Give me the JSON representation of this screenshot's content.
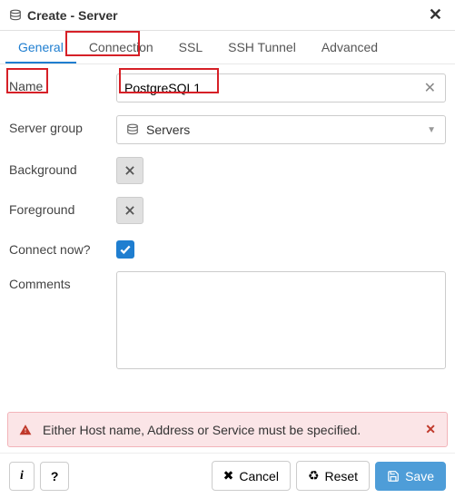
{
  "title": "Create - Server",
  "tabs": [
    {
      "label": "General",
      "active": true
    },
    {
      "label": "Connection",
      "active": false
    },
    {
      "label": "SSL",
      "active": false
    },
    {
      "label": "SSH Tunnel",
      "active": false
    },
    {
      "label": "Advanced",
      "active": false
    }
  ],
  "form": {
    "name_label": "Name",
    "name_value": "PostgreSQL1",
    "server_group_label": "Server group",
    "server_group_value": "Servers",
    "background_label": "Background",
    "foreground_label": "Foreground",
    "connect_now_label": "Connect now?",
    "connect_now_checked": true,
    "comments_label": "Comments",
    "comments_value": ""
  },
  "alert": {
    "text": "Either Host name, Address or Service must be specified."
  },
  "footer": {
    "info_label": "i",
    "help_label": "?",
    "cancel_label": "Cancel",
    "reset_label": "Reset",
    "save_label": "Save"
  }
}
